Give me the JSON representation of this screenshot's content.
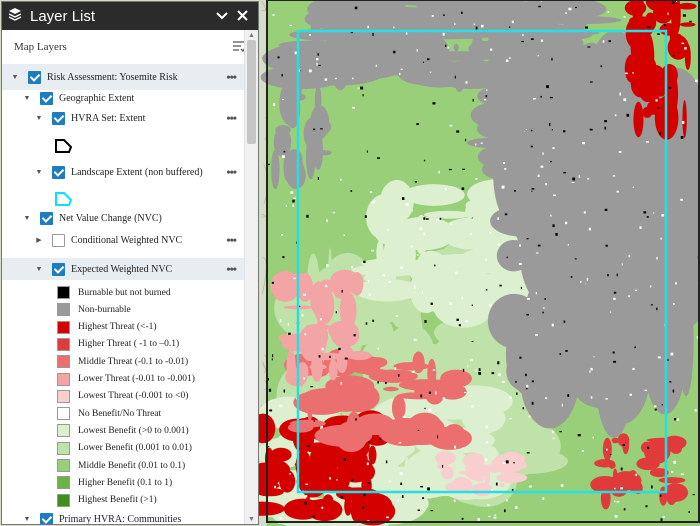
{
  "panel": {
    "title": "Layer List",
    "toolbar_label": "Map Layers",
    "icons": {
      "layers": "layers-icon",
      "collapse": "chevron-down-icon",
      "close": "close-icon",
      "options": "list-options-icon"
    }
  },
  "layers": [
    {
      "label": "Risk Assessment: Yosemite Risk",
      "checked": true,
      "caret": "down",
      "more": true
    },
    {
      "label": "Geographic Extent",
      "checked": true,
      "caret": "down",
      "more": false
    },
    {
      "label": "HVRA Set: Extent",
      "checked": true,
      "caret": "down",
      "more": true
    },
    {
      "label": "Landscape Extent (non buffered)",
      "checked": true,
      "caret": "down",
      "more": true
    },
    {
      "label": "Net Value Change (NVC)",
      "checked": true,
      "caret": "down",
      "more": false
    },
    {
      "label": "Conditional Weighted NVC",
      "checked": false,
      "caret": "right",
      "more": true
    },
    {
      "label": "Expected Weighted NVC",
      "checked": true,
      "caret": "down",
      "more": true
    },
    {
      "label": "Primary HVRA: Communities",
      "checked": true,
      "caret": "down",
      "more": false
    }
  ],
  "symbols": {
    "hvra_extent": "#000000",
    "landscape_extent": "#00e5ff"
  },
  "legend": [
    {
      "label": "Burnable but not burned",
      "color": "#000000"
    },
    {
      "label": "Non-burnable",
      "color": "#9a9a9a"
    },
    {
      "label": "Highest Threat (<-1)",
      "color": "#d40000"
    },
    {
      "label": "Higher Threat ( -1 to –0.1)",
      "color": "#e03a3a"
    },
    {
      "label": "Middle Threat (-0.1 to -0.01)",
      "color": "#eb6f6f"
    },
    {
      "label": "Lower Threat (-0.01 to -0.001)",
      "color": "#f3a4a4"
    },
    {
      "label": "Lowest Threat (-0.001 to <0)",
      "color": "#f8cece"
    },
    {
      "label": "No Benefit/No Threat",
      "color": "#ffffff"
    },
    {
      "label": "Lowest Benefit (>0 to 0.001)",
      "color": "#dcefcf"
    },
    {
      "label": "Lower Benefit (0.001 to 0.01)",
      "color": "#bfe2a8"
    },
    {
      "label": "Middle Benefit (0.01 to 0.1)",
      "color": "#98cf78"
    },
    {
      "label": "Higher Benefit (0.1 to 1)",
      "color": "#6ab347"
    },
    {
      "label": "Highest Benefit (>1)",
      "color": "#3f8f1e"
    }
  ],
  "map": {
    "extent_color": "#22e0e8"
  }
}
